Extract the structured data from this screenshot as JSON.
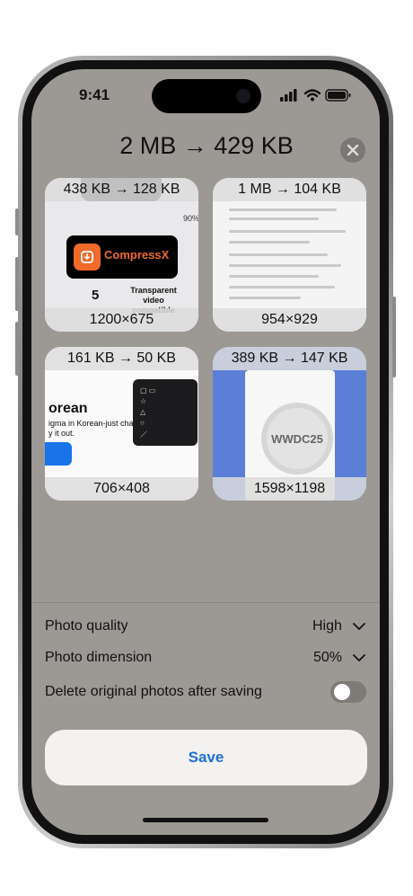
{
  "status_bar": {
    "time": "9:41"
  },
  "header": {
    "title": "2 MB → 429 KB"
  },
  "cards": [
    {
      "top": "438 KB → 128 KB",
      "bottom": "1200×675",
      "thumb_text": {
        "logo": "CompressX",
        "number": "5",
        "caption": "Transparent video compatible",
        "side": "90%"
      }
    },
    {
      "top": "1 MB → 104 KB",
      "bottom": "954×929"
    },
    {
      "top": "161 KB → 50 KB",
      "bottom": "706×408",
      "thumb_text": {
        "heading": "orean",
        "body1": "igma in Korean-just change",
        "body2": "y it out."
      }
    },
    {
      "top": "389 KB → 147 KB",
      "bottom": "1598×1198",
      "thumb_text": {
        "badge": "WWDC25"
      }
    }
  ],
  "settings": {
    "photo_quality": {
      "label": "Photo quality",
      "value": "High"
    },
    "photo_dimension": {
      "label": "Photo dimension",
      "value": "50%"
    },
    "delete_original": {
      "label": "Delete original photos after saving",
      "enabled": false
    }
  },
  "save_button": {
    "label": "Save"
  },
  "colors": {
    "accent": "#1f6fd6",
    "screen_bg": "#9c9995",
    "brand_orange": "#f06a2a"
  }
}
